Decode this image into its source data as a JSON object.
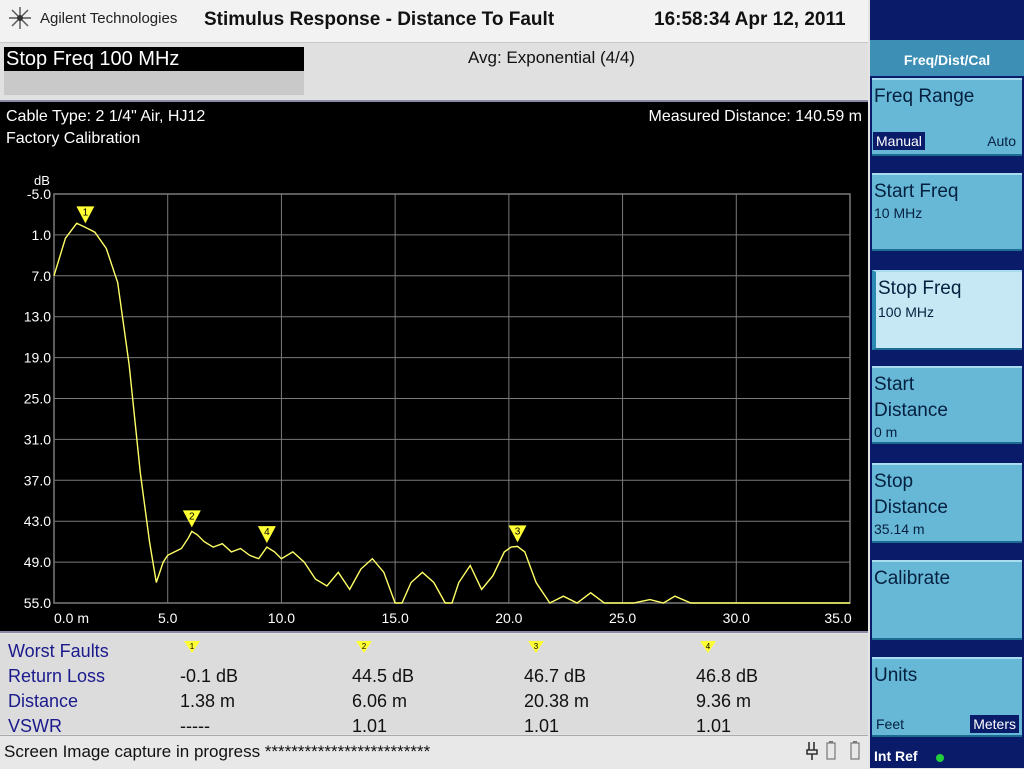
{
  "header": {
    "brand": "Agilent Technologies",
    "title": "Stimulus Response - Distance To Fault",
    "clock": "16:58:34  Apr 12, 2011"
  },
  "infobar": {
    "stop_freq": "Stop Freq 100 MHz",
    "avg": "Avg: Exponential (4/4)"
  },
  "plot": {
    "cable_type": "Cable Type: 2 1/4\" Air, HJ12",
    "calibration": "Factory Calibration",
    "measured_distance": "Measured Distance: 140.59 m"
  },
  "chart_data": {
    "type": "line",
    "ylabel": "dB",
    "xlim": [
      0,
      35
    ],
    "ylim": [
      -5,
      55
    ],
    "y_inverted": true,
    "x_ticks": [
      "0.0 m",
      "5.0",
      "10.0",
      "15.0",
      "20.0",
      "25.0",
      "30.0",
      "35.0"
    ],
    "y_ticks": [
      "-5.0",
      "1.0",
      "7.0",
      "13.0",
      "19.0",
      "25.0",
      "31.0",
      "37.0",
      "43.0",
      "49.0",
      "55.0"
    ],
    "grid": true,
    "trace_color": "#ffff66",
    "series": [
      {
        "x": [
          0,
          0.5,
          1.0,
          1.38,
          1.8,
          2.3,
          2.8,
          3.3,
          3.8,
          4.2,
          4.5,
          4.8,
          5.0,
          5.3,
          5.6,
          5.9,
          6.06,
          6.3,
          6.6,
          7.0,
          7.4,
          7.8,
          8.2,
          8.6,
          9.0,
          9.36,
          9.7,
          10.0,
          10.5,
          11.0,
          11.5,
          12.0,
          12.5,
          13.0,
          13.5,
          14.0,
          14.5,
          15.0,
          15.3,
          15.7,
          16.2,
          16.7,
          17.2,
          17.5,
          17.8,
          18.3,
          18.8,
          19.3,
          19.8,
          20.1,
          20.38,
          20.7,
          21.2,
          21.8,
          22.4,
          23.0,
          23.6,
          24.2,
          24.8,
          25.5,
          26.2,
          26.8,
          27.3,
          28.0,
          30.0,
          35.0
        ],
        "y": [
          7.0,
          1.5,
          -0.7,
          -0.1,
          0.6,
          3.0,
          8.0,
          20.0,
          36.0,
          46.0,
          52.0,
          49.0,
          48.0,
          47.5,
          47.0,
          45.5,
          44.5,
          45.0,
          46.0,
          46.8,
          46.3,
          47.5,
          47.0,
          48.0,
          48.5,
          46.8,
          47.5,
          48.5,
          47.5,
          49.0,
          51.5,
          52.5,
          50.5,
          53.0,
          50.0,
          48.5,
          50.5,
          55.0,
          55.0,
          52.0,
          50.5,
          52.0,
          55.0,
          55.0,
          52.0,
          49.5,
          53.0,
          51.0,
          47.5,
          46.8,
          46.7,
          47.5,
          52.0,
          55.0,
          54.0,
          55.0,
          53.5,
          55.0,
          55.0,
          55.0,
          54.5,
          55.0,
          54.0,
          55.0,
          55.0,
          55.0
        ]
      }
    ],
    "markers": [
      {
        "id": "1",
        "x": 1.38,
        "y": -0.1
      },
      {
        "id": "2",
        "x": 6.06,
        "y": 44.5
      },
      {
        "id": "3",
        "x": 20.38,
        "y": 46.7
      },
      {
        "id": "4",
        "x": 9.36,
        "y": 46.8
      }
    ]
  },
  "faults": {
    "title": "Worst Faults",
    "row_labels": [
      "Return Loss",
      "Distance",
      "VSWR"
    ],
    "columns": [
      {
        "marker": "1",
        "return_loss": "-0.1 dB",
        "distance": "1.38 m",
        "vswr": "-----"
      },
      {
        "marker": "2",
        "return_loss": "44.5 dB",
        "distance": "6.06 m",
        "vswr": "1.01"
      },
      {
        "marker": "3",
        "return_loss": "46.7 dB",
        "distance": "20.38 m",
        "vswr": "1.01"
      },
      {
        "marker": "4",
        "return_loss": "46.8 dB",
        "distance": "9.36 m",
        "vswr": "1.01"
      }
    ]
  },
  "status": {
    "text": "Screen Image capture in progress   *************************",
    "ref": "Int Ref"
  },
  "softkeys": {
    "menu_title": "Freq/Dist/Cal",
    "freq_range": {
      "label": "Freq Range",
      "opt_manual": "Manual",
      "opt_auto": "Auto"
    },
    "start_freq": {
      "label": "Start Freq",
      "value": "10 MHz"
    },
    "stop_freq": {
      "label": "Stop Freq",
      "value": "100 MHz"
    },
    "start_distance": {
      "label1": "Start",
      "label2": "Distance",
      "value": "0 m"
    },
    "stop_distance": {
      "label1": "Stop",
      "label2": "Distance",
      "value": "35.14 m"
    },
    "calibrate": {
      "label": "Calibrate"
    },
    "units": {
      "label": "Units",
      "opt_feet": "Feet",
      "opt_meters": "Meters"
    }
  },
  "colors": {
    "plot_bg": "#000000",
    "grid": "#7a7a7a",
    "trace": "#ffff66",
    "marker": "#ffff33",
    "softkey": "#66b8d6",
    "softkey_panel": "#0a1b6a"
  }
}
